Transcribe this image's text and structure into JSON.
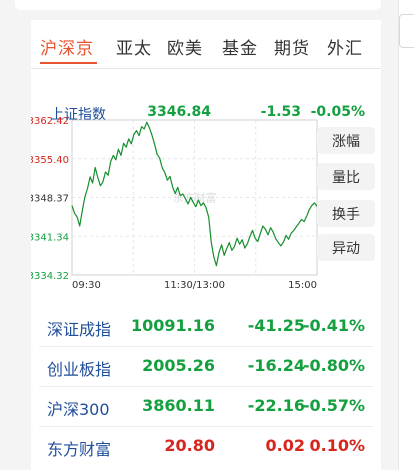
{
  "tabs": [
    {
      "label": "沪深京",
      "active": true
    },
    {
      "label": "亚太"
    },
    {
      "label": "欧美"
    },
    {
      "label": "基金"
    },
    {
      "label": "期货"
    },
    {
      "label": "外汇"
    }
  ],
  "main_index": {
    "name": "上证指数",
    "price": "3346.84",
    "change": "-1.53",
    "pct": "-0.05%"
  },
  "chart_data": {
    "type": "line",
    "y_ticks": [
      "3362.42",
      "3355.40",
      "3348.37",
      "3341.34",
      "3334.32"
    ],
    "x_ticks": [
      "09:30",
      "11:30/13:00",
      "15:00"
    ],
    "ylim": [
      3334.32,
      3362.42
    ],
    "baseline": 3348.37,
    "watermark": "东方财富",
    "series": [
      {
        "values": [
          3346.9,
          3345.5,
          3344.8,
          3343.2,
          3346.0,
          3348.5,
          3350.0,
          3352.1,
          3351.0,
          3353.8,
          3352.0,
          3350.5,
          3351.2,
          3353.0,
          3352.4,
          3354.9,
          3356.0,
          3355.2,
          3357.1,
          3356.0,
          3358.2,
          3357.5,
          3359.0,
          3358.1,
          3359.8,
          3360.5,
          3359.6,
          3361.2,
          3360.8,
          3362.0,
          3361.0,
          3359.7,
          3358.1,
          3356.2,
          3355.5,
          3353.7,
          3352.9,
          3351.5,
          3352.2,
          3350.3,
          3349.1,
          3350.2,
          3348.7,
          3349.0,
          3348.1,
          3347.2,
          3348.4,
          3347.5,
          3346.7,
          3347.9,
          3346.9,
          3347.4,
          3346.5,
          3344.8,
          3340.2,
          3337.6,
          3336.0,
          3338.4,
          3339.8,
          3337.9,
          3339.1,
          3340.2,
          3338.8,
          3339.5,
          3341.0,
          3339.9,
          3340.7,
          3339.2,
          3340.0,
          3341.3,
          3342.4,
          3341.0,
          3340.4,
          3341.8,
          3343.2,
          3342.6,
          3341.6,
          3342.9,
          3342.1,
          3340.9,
          3340.2,
          3339.6,
          3340.3,
          3341.5,
          3340.8,
          3341.9,
          3342.4,
          3343.1,
          3343.7,
          3344.4,
          3344.0,
          3345.0,
          3346.2,
          3346.9,
          3347.4,
          3346.8
        ]
      }
    ]
  },
  "side_buttons": [
    "涨幅",
    "量比",
    "换手",
    "异动"
  ],
  "indices": [
    {
      "name": "深证成指",
      "price": "10091.16",
      "change": "-41.25",
      "pct": "-0.41%",
      "dir": "down"
    },
    {
      "name": "创业板指",
      "price": "2005.26",
      "change": "-16.24",
      "pct": "-0.80%",
      "dir": "down"
    },
    {
      "name": "沪深300",
      "price": "3860.11",
      "change": "-22.16",
      "pct": "-0.57%",
      "dir": "down"
    },
    {
      "name": "东方财富",
      "price": "20.80",
      "change": "0.02",
      "pct": "0.10%",
      "dir": "up"
    }
  ],
  "colors": {
    "accent": "#e8542f",
    "down": "#15a040",
    "up": "#d6261d",
    "name_blue": "#1f4e9a"
  }
}
